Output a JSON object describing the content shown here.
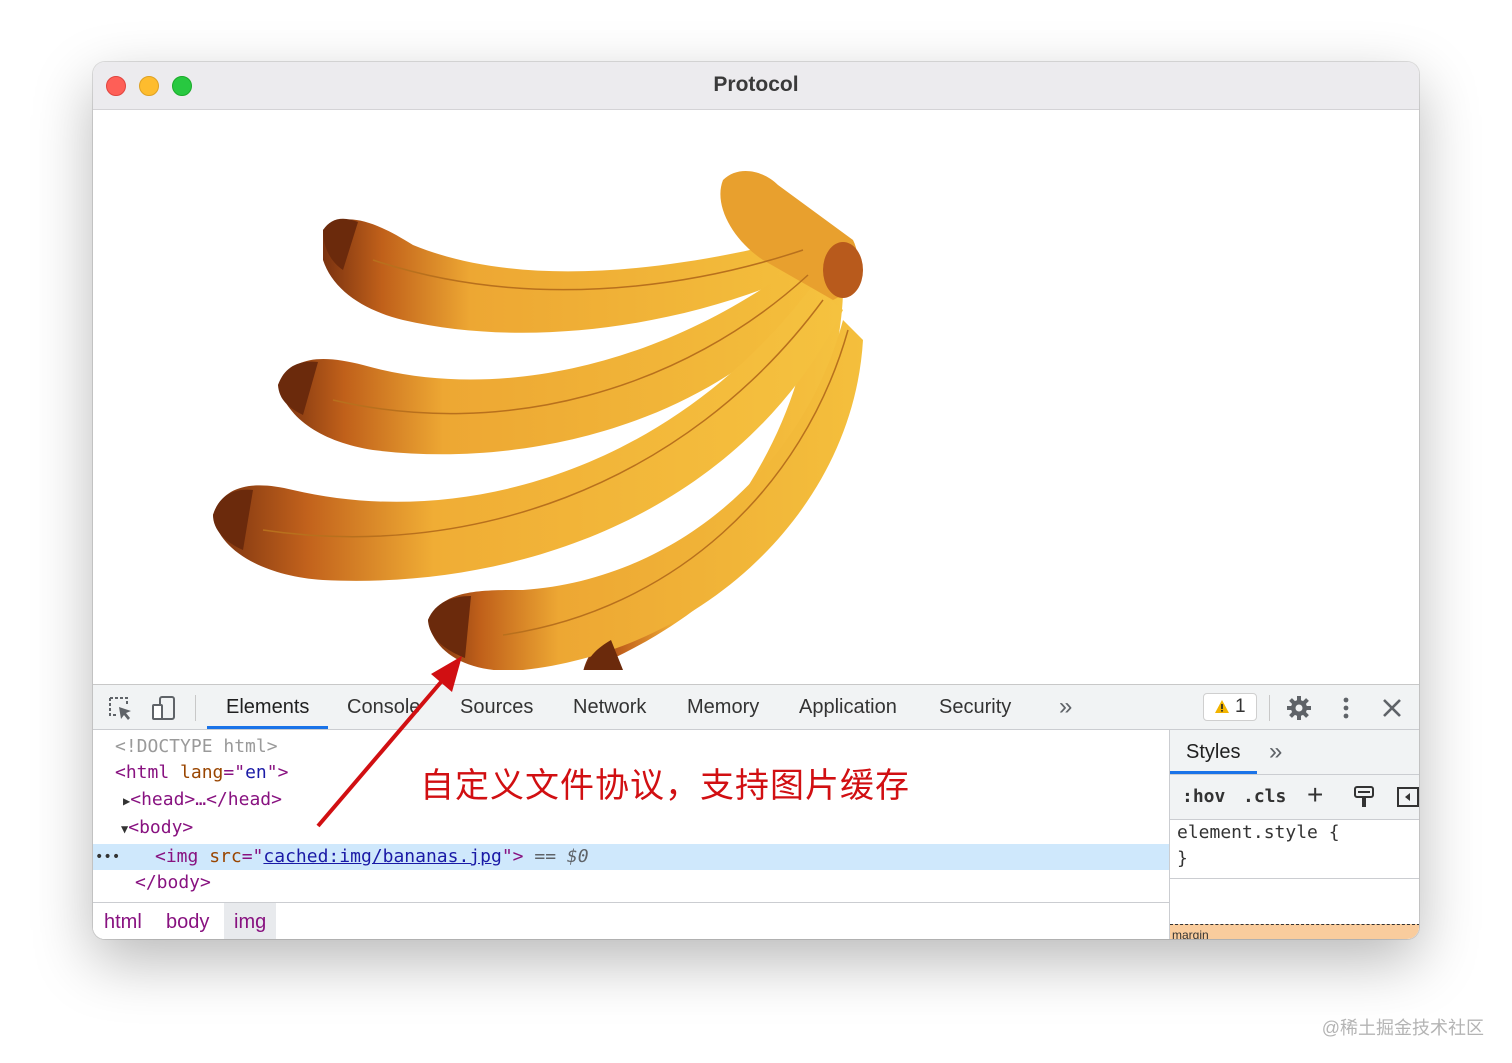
{
  "window": {
    "title": "Protocol"
  },
  "devtools": {
    "tabs": [
      "Elements",
      "Console",
      "Sources",
      "Network",
      "Memory",
      "Application",
      "Security"
    ],
    "active_tab": "Elements",
    "more_tabs_glyph": "»",
    "warning_count": "1",
    "elements": {
      "doctype": "<!DOCTYPE html>",
      "html_open": {
        "tag": "<html",
        "attr_name": "lang",
        "attr_eq": "=\"",
        "attr_value": "en",
        "close": "\">"
      },
      "head_line": "<head>…</head>",
      "body_open": "<body>",
      "img_line": {
        "tag": "<img",
        "attr_name": "src",
        "attr_eq": "=\"",
        "attr_value": "cached:img/bananas.jpg",
        "close": "\">",
        "eq": " == ",
        "ref": "$0"
      },
      "body_close": "</body>",
      "row_dots": "•••"
    },
    "breadcrumbs": [
      "html",
      "body",
      "img"
    ],
    "styles": {
      "tab_label": "Styles",
      "more_glyph": "»",
      "hov": ":hov",
      "cls": ".cls",
      "plus": "+",
      "rule_selector": "element.style {",
      "rule_close": "}",
      "box_label": "margin"
    }
  },
  "annotation": {
    "text": "自定义文件协议，支持图片缓存",
    "color": "#d10f12"
  },
  "watermark": "@稀土掘金技术社区",
  "colors": {
    "accent": "#1a73e8",
    "tag": "#881280",
    "attr_name": "#994500",
    "attr_value": "#1a1aa6",
    "link": "#1a1aa6",
    "warning": "#f2b400",
    "banana": "#f2b534"
  }
}
